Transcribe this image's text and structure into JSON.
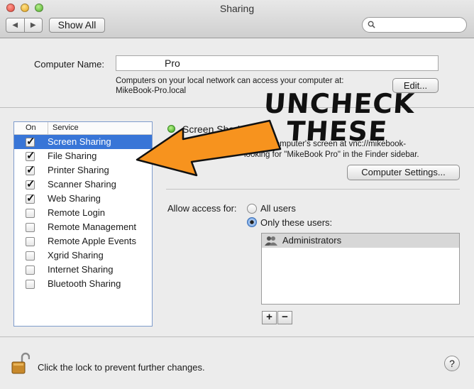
{
  "window": {
    "title": "Sharing"
  },
  "toolbar": {
    "back": "◀",
    "forward": "▶",
    "show_all": "Show All",
    "search_placeholder": ""
  },
  "computer": {
    "name_label": "Computer Name:",
    "name_value": "Pro",
    "info_line1": "Computers on your local network can access your computer at:",
    "info_line2": "MikeBook-Pro.local",
    "edit_button": "Edit..."
  },
  "services": {
    "header_on": "On",
    "header_service": "Service",
    "items": [
      {
        "name": "Screen Sharing",
        "checked": true,
        "selected": true
      },
      {
        "name": "File Sharing",
        "checked": true
      },
      {
        "name": "Printer Sharing",
        "checked": true
      },
      {
        "name": "Scanner Sharing",
        "checked": true
      },
      {
        "name": "Web Sharing",
        "checked": true
      },
      {
        "name": "Remote Login",
        "checked": false
      },
      {
        "name": "Remote Management",
        "checked": false
      },
      {
        "name": "Remote Apple Events",
        "checked": false
      },
      {
        "name": "Xgrid Sharing",
        "checked": false
      },
      {
        "name": "Internet Sharing",
        "checked": false
      },
      {
        "name": "Bluetooth Sharing",
        "checked": false
      }
    ]
  },
  "detail": {
    "status": "Screen Sharing",
    "desc_line1": "computer's screen at vnc://mikebook-",
    "desc_line2": "looking for \"MikeBook Pro\" in the Finder sidebar.",
    "computer_settings_button": "Computer Settings...",
    "allow_access_label": "Allow access for:",
    "radio_all": "All users",
    "radio_only": "Only these users:",
    "users": [
      "Administrators"
    ],
    "add": "+",
    "remove": "−"
  },
  "footer": {
    "lock_text": "Click the lock to prevent further changes.",
    "help": "?"
  },
  "annotation": {
    "line1": "UNCHECK",
    "line2": "THESE",
    "arrow_color": "#f7931e"
  }
}
